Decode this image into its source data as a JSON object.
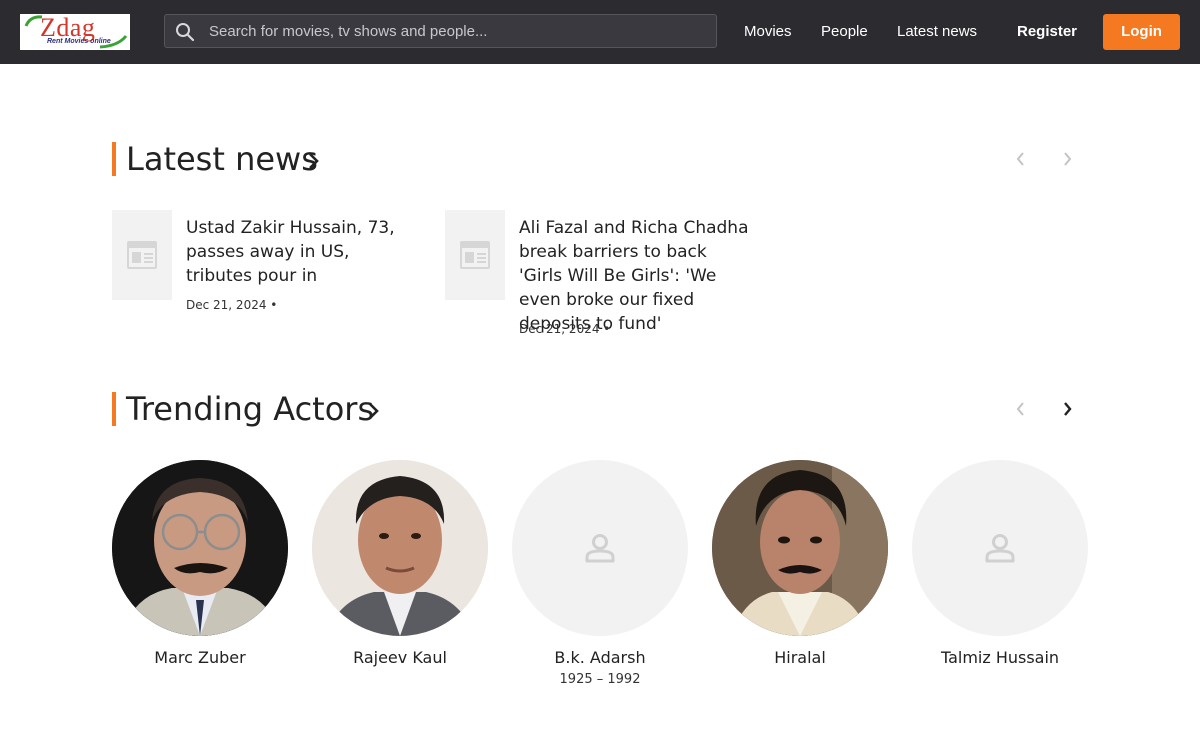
{
  "header": {
    "logo_text": "Zdag",
    "logo_tagline": "Rent Movies online",
    "search_placeholder": "Search for movies, tv shows and people...",
    "nav": [
      "Movies",
      "People",
      "Latest news"
    ],
    "register_label": "Register",
    "login_label": "Login",
    "accent_color": "#f47920"
  },
  "latest_news": {
    "title": "Latest news",
    "items": [
      {
        "title": "Ustad Zakir Hussain, 73, passes away in US, tributes pour in",
        "date": "Dec 21, 2024 •"
      },
      {
        "title": "Ali Fazal and Richa Chadha break barriers to back 'Girls Will Be Girls': 'We even broke our fixed deposits to fund'",
        "date": "Dec 21, 2024 •"
      }
    ]
  },
  "trending_actors": {
    "title": "Trending Actors",
    "actors": [
      {
        "name": "Marc Zuber",
        "years": "",
        "photo": "portrait"
      },
      {
        "name": "Rajeev Kaul",
        "years": "",
        "photo": "portrait"
      },
      {
        "name": "B.k. Adarsh",
        "years": "1925 – 1992",
        "photo": "placeholder-person-icon"
      },
      {
        "name": "Hiralal",
        "years": "",
        "photo": "portrait"
      },
      {
        "name": "Talmiz Hussain",
        "years": "",
        "photo": "placeholder-person-icon"
      }
    ]
  }
}
